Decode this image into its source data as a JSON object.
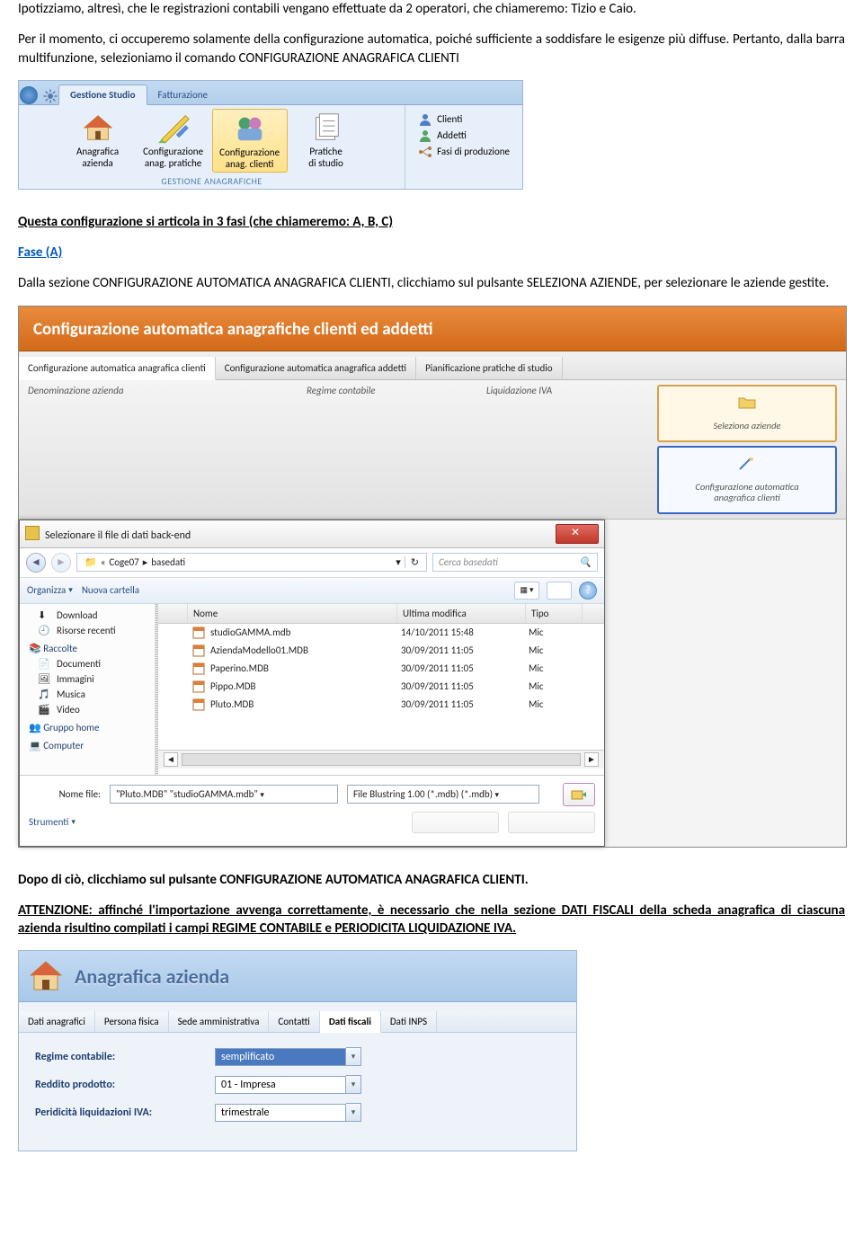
{
  "intro": {
    "p1": "Ipotizziamo, altresì, che le registrazioni contabili vengano effettuate da 2 operatori, che chiameremo: Tizio e Caio.",
    "p2": "Per il momento, ci occuperemo solamente della configurazione automatica, poiché sufficiente a soddisfare le esigenze più diffuse. Pertanto, dalla barra multifunzione, selezioniamo il comando CONFIGURAZIONE ANAGRAFICA CLIENTI"
  },
  "ribbon": {
    "tabs": {
      "gestione": "Gestione Studio",
      "fatturazione": "Fatturazione"
    },
    "items": {
      "anag_azienda": "Anagrafica\nazienda",
      "conf_pratiche": "Configurazione\nanag. pratiche",
      "conf_clienti": "Configurazione\nanag. clienti",
      "pratiche_studio": "Pratiche\ndi studio"
    },
    "group_label": "GESTIONE ANAGRAFICHE",
    "mini": {
      "clienti": "Clienti",
      "addetti": "Addetti",
      "fasi": "Fasi di produzione"
    }
  },
  "mid_text": {
    "fasi_title": "Questa  configurazione si articola in 3 fasi  (che chiameremo: A, B, C)",
    "fase_a_label": "Fase (A)",
    "fase_a_body": "Dalla sezione CONFIGURAZIONE AUTOMATICA ANAGRAFICA CLIENTI, clicchiamo sul pulsante SELEZIONA AZIENDE, per selezionare le aziende gestite."
  },
  "appwin": {
    "title": "Configurazione automatica anagrafiche clienti ed addetti",
    "tabs": {
      "t1": "Configurazione automatica anagrafica clienti",
      "t2": "Configurazione automatica anagrafica addetti",
      "t3": "Pianificazione pratiche di studio"
    },
    "cols": {
      "c1": "Denominazione azienda",
      "c2": "Regime contabile",
      "c3": "Liquidazione IVA"
    },
    "btn1": "Seleziona aziende",
    "btn2": "Configurazione automatica\nanagrafica clienti"
  },
  "filedlg": {
    "title": "Selezionare il file di dati back-end",
    "path": {
      "seg1": "Coge07",
      "seg2": "basedati"
    },
    "search_placeholder": "Cerca basedati",
    "toolbar": {
      "organizza": "Organizza",
      "nuova": "Nuova cartella"
    },
    "sidebar": {
      "download": "Download",
      "recenti": "Risorse recenti",
      "raccolte": "Raccolte",
      "documenti": "Documenti",
      "immagini": "Immagini",
      "musica": "Musica",
      "video": "Video",
      "gruppo": "Gruppo home",
      "computer": "Computer"
    },
    "list": {
      "hdr": {
        "nome": "Nome",
        "modifica": "Ultima modifica",
        "tipo": "Tipo"
      },
      "rows": [
        {
          "name": "studioGAMMA.mdb",
          "date": "14/10/2011 15:48",
          "type": "Mic"
        },
        {
          "name": "AziendaModello01.MDB",
          "date": "30/09/2011 11:05",
          "type": "Mic"
        },
        {
          "name": "Paperino.MDB",
          "date": "30/09/2011 11:05",
          "type": "Mic"
        },
        {
          "name": "Pippo.MDB",
          "date": "30/09/2011 11:05",
          "type": "Mic"
        },
        {
          "name": "Pluto.MDB",
          "date": "30/09/2011 11:05",
          "type": "Mic"
        }
      ]
    },
    "bottom": {
      "nome_lbl": "Nome file:",
      "nome_val": "\"Pluto.MDB\" \"studioGAMMA.mdb\"",
      "filetype": "File Blustring 1.00 (*.mdb) (*.mdb)",
      "strumenti": "Strumenti"
    }
  },
  "after_text": {
    "p1": "Dopo di ciò, clicchiamo sul pulsante CONFIGURAZIONE AUTOMATICA ANAGRAFICA CLIENTI.",
    "p2": "ATTENZIONE: affinché l'importazione avvenga correttamente, è necessario che nella sezione DATI FISCALI della scheda anagrafica di ciascuna azienda risultino compilati i campi REGIME CONTABILE e PERIODICITA LIQUIDAZIONE IVA."
  },
  "anag": {
    "title": "Anagrafica azienda",
    "tabs": {
      "t1": "Dati anagrafici",
      "t2": "Persona fisica",
      "t3": "Sede amministrativa",
      "t4": "Contatti",
      "t5": "Dati fiscali",
      "t6": "Dati INPS"
    },
    "rows": {
      "regime_lbl": "Regime contabile:",
      "regime_val": "semplificato",
      "reddito_lbl": "Reddito prodotto:",
      "reddito_val": "01 - Impresa",
      "period_lbl": "Peridicità liquidazioni IVA:",
      "period_val": "trimestrale"
    }
  }
}
